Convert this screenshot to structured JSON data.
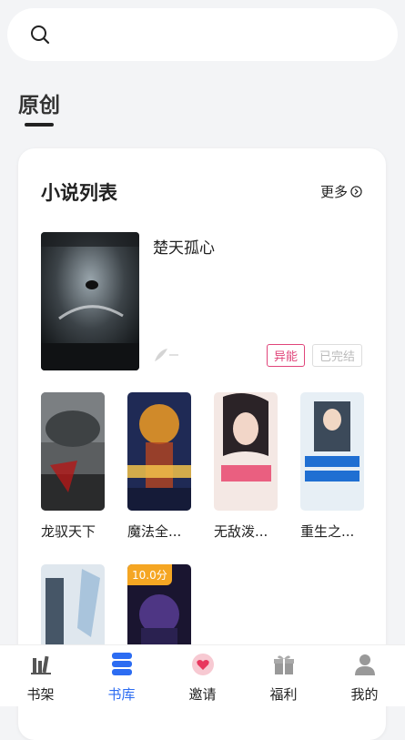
{
  "section": {
    "title": "原创"
  },
  "card": {
    "title": "小说列表",
    "more_label": "更多",
    "featured": {
      "title": "楚天孤心",
      "tags": [
        "异能",
        "已完结"
      ]
    },
    "books": [
      {
        "name": "龙驭天下"
      },
      {
        "name": "魔法全..."
      },
      {
        "name": "无敌泼..."
      },
      {
        "name": "重生之..."
      },
      {
        "name": ""
      },
      {
        "name": "",
        "score": "10.0分"
      }
    ]
  },
  "tabs": [
    {
      "label": "书架",
      "icon": "bookshelf-icon"
    },
    {
      "label": "书库",
      "icon": "library-icon",
      "active": true
    },
    {
      "label": "邀请",
      "icon": "heart-icon"
    },
    {
      "label": "福利",
      "icon": "gift-icon"
    },
    {
      "label": "我的",
      "icon": "user-icon"
    }
  ],
  "colors": {
    "accent": "#2c6cf2",
    "tag_pink": "#e0457a",
    "score": "#f5a623"
  }
}
